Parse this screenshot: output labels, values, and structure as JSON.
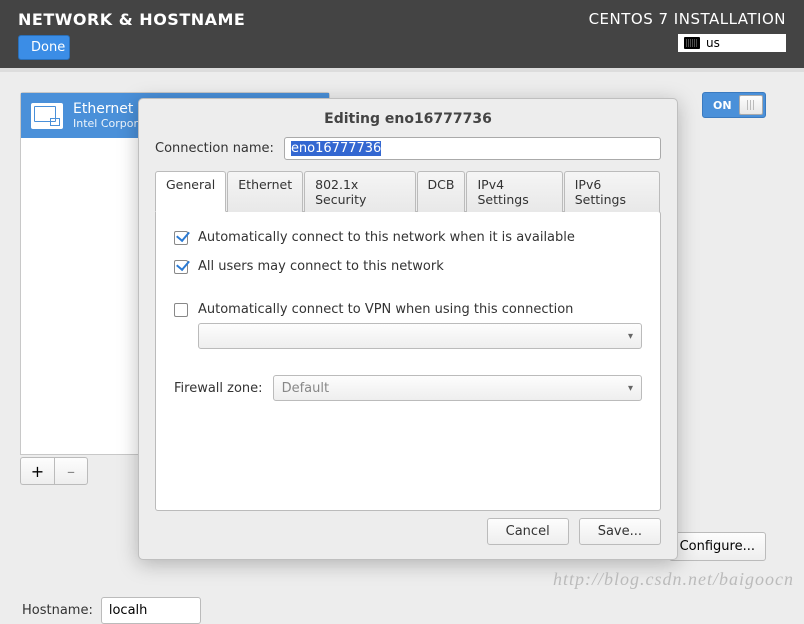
{
  "topbar": {
    "title": "NETWORK & HOSTNAME",
    "done": "Done",
    "install_title": "CENTOS 7 INSTALLATION",
    "keyboard": "us"
  },
  "interface": {
    "name": "Ethernet (",
    "vendor": "Intel Corporat",
    "toggle": "ON",
    "configure": "Configure..."
  },
  "controls": {
    "add": "+",
    "remove": "–"
  },
  "hostname": {
    "label": "Hostname:",
    "value": "localh"
  },
  "dialog": {
    "title": "Editing eno16777736",
    "conn_name_label": "Connection name:",
    "conn_name_value": "eno16777736",
    "tabs": [
      "General",
      "Ethernet",
      "802.1x Security",
      "DCB",
      "IPv4 Settings",
      "IPv6 Settings"
    ],
    "active_tab": 0,
    "chk_auto": "Automatically connect to this network when it is available",
    "chk_allusers": "All users may connect to this network",
    "chk_vpn": "Automatically connect to VPN when using this connection",
    "vpn_combo": "",
    "fw_label": "Firewall zone:",
    "fw_value": "Default",
    "cancel": "Cancel",
    "save": "Save..."
  },
  "watermark": "http://blog.csdn.net/baigoocn"
}
